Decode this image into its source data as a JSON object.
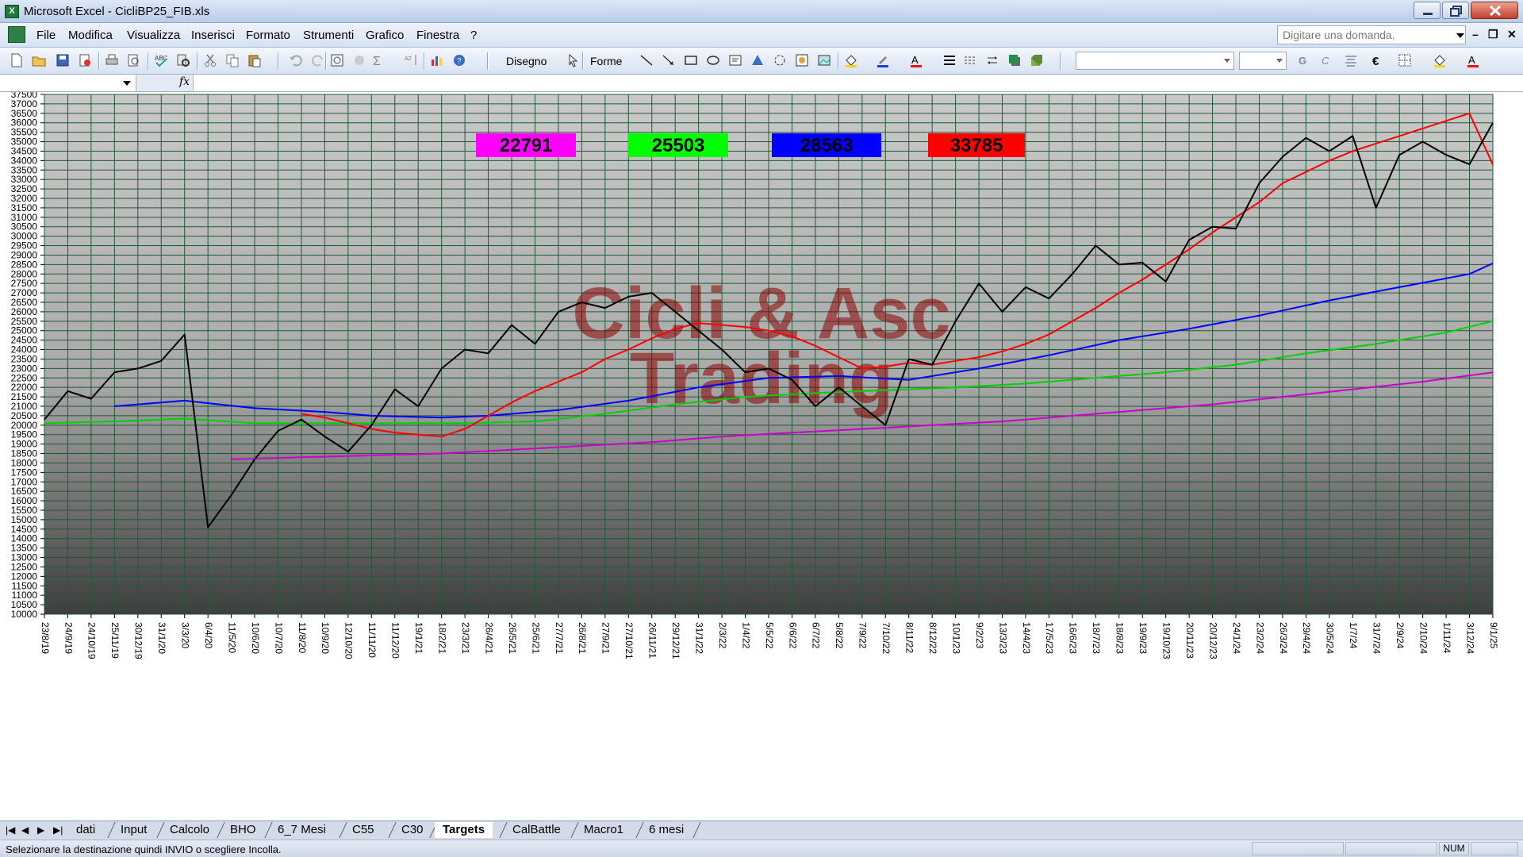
{
  "window": {
    "title": "Microsoft Excel - CicliBP25_FIB.xls",
    "app_icon": "excel-icon"
  },
  "menu": {
    "items": [
      "File",
      "Modifica",
      "Visualizza",
      "Inserisci",
      "Formato",
      "Strumenti",
      "Grafico",
      "Finestra",
      "?"
    ],
    "ask_placeholder": "Digitare una domanda."
  },
  "toolbar": {
    "disegno_label": "Disegno",
    "forme_label": "Forme"
  },
  "chart_data": {
    "type": "line",
    "ylim": [
      10000,
      37500
    ],
    "yticks": [
      10000,
      10500,
      11000,
      11500,
      12000,
      12500,
      13000,
      13500,
      14000,
      14500,
      15000,
      15500,
      16000,
      16500,
      17000,
      17500,
      18000,
      18500,
      19000,
      19500,
      20000,
      20500,
      21000,
      21500,
      22000,
      22500,
      23000,
      23500,
      24000,
      24500,
      25000,
      25500,
      26000,
      26500,
      27000,
      27500,
      28000,
      28500,
      29000,
      29500,
      30000,
      30500,
      31000,
      31500,
      32000,
      32500,
      33000,
      33500,
      34000,
      34500,
      35000,
      35500,
      36000,
      36500,
      37000,
      37500
    ],
    "x_tick_labels": [
      "23/8/19",
      "24/9/19",
      "24/10/19",
      "25/11/19",
      "30/12/19",
      "31/1/20",
      "3/3/20",
      "6/4/20",
      "11/5/20",
      "10/6/20",
      "10/7/20",
      "11/8/20",
      "10/9/20",
      "12/10/20",
      "11/11/20",
      "11/12/20",
      "19/1/21",
      "18/2/21",
      "23/3/21",
      "26/4/21",
      "26/5/21",
      "25/6/21",
      "27/7/21",
      "26/8/21",
      "27/9/21",
      "27/10/21",
      "26/11/21",
      "29/12/21",
      "31/1/22",
      "2/3/22",
      "1/4/22",
      "5/5/22",
      "6/6/22",
      "6/7/22",
      "5/8/22",
      "7/9/22",
      "7/10/22",
      "8/11/22",
      "8/12/22",
      "10/1/23",
      "9/2/23",
      "13/3/23",
      "14/4/23",
      "17/5/23",
      "16/6/23",
      "18/7/23",
      "18/8/23",
      "19/9/23",
      "19/10/23",
      "20/11/23",
      "20/12/23",
      "24/1/24",
      "23/2/24",
      "26/3/24",
      "29/4/24",
      "30/5/24",
      "1/7/24",
      "31/7/24",
      "2/9/24",
      "2/10/24",
      "1/11/24",
      "3/12/24",
      "9/1/25"
    ],
    "badges": [
      {
        "value": "22791",
        "color": "#ff00ff"
      },
      {
        "value": "25503",
        "color": "#00ff00"
      },
      {
        "value": "28563",
        "color": "#0000ff"
      },
      {
        "value": "33785",
        "color": "#ff0000"
      }
    ],
    "watermark_line1": "Cicli & Asc",
    "watermark_line2": "Trading",
    "series": [
      {
        "color": "#000000",
        "x": [
          0,
          1,
          2,
          3,
          4,
          5,
          6,
          7,
          8,
          9,
          10,
          11,
          12,
          13,
          14,
          15,
          16,
          17,
          18,
          19,
          20,
          21,
          22,
          23,
          24,
          25,
          26,
          27,
          28,
          29,
          30,
          31,
          32,
          33,
          34,
          35,
          36,
          37,
          38,
          39,
          40,
          41,
          42,
          43,
          44,
          45,
          46,
          47,
          48,
          49,
          50,
          51,
          52,
          53,
          54,
          55,
          56,
          57,
          58,
          59,
          60,
          61,
          62
        ],
        "y": [
          20300,
          21800,
          21400,
          22800,
          23000,
          23400,
          24800,
          14600,
          16300,
          18200,
          19700,
          20300,
          19400,
          18600,
          20000,
          21900,
          21000,
          23000,
          24000,
          23800,
          25300,
          24300,
          26000,
          26500,
          26200,
          26800,
          27000,
          26000,
          25000,
          24000,
          22800,
          23000,
          22400,
          21000,
          22000,
          21000,
          20000,
          23500,
          23200,
          25500,
          27500,
          26000,
          27300,
          26700,
          28000,
          29500,
          28500,
          28600,
          27600,
          29800,
          30500,
          30400,
          32800,
          34200,
          35200,
          34500,
          35300,
          31500,
          34300,
          35000,
          34300,
          33800,
          36000
        ]
      },
      {
        "color": "#ff0000",
        "x": [
          11,
          12,
          13,
          14,
          15,
          16,
          17,
          18,
          19,
          20,
          21,
          22,
          23,
          24,
          25,
          26,
          27,
          28,
          29,
          30,
          31,
          32,
          33,
          34,
          35,
          36,
          37,
          38,
          39,
          40,
          41,
          42,
          43,
          44,
          45,
          46,
          47,
          48,
          49,
          50,
          51,
          52,
          53,
          54,
          55,
          56,
          57,
          58,
          59,
          60,
          61,
          62
        ],
        "y": [
          20600,
          20400,
          20100,
          19800,
          19600,
          19500,
          19400,
          19800,
          20500,
          21200,
          21800,
          22300,
          22800,
          23500,
          24000,
          24600,
          25100,
          25400,
          25300,
          25200,
          25000,
          24700,
          24200,
          23600,
          23000,
          23100,
          23300,
          23200,
          23400,
          23600,
          23900,
          24300,
          24800,
          25500,
          26200,
          27000,
          27700,
          28500,
          29300,
          30200,
          31000,
          31800,
          32800,
          33400,
          34000,
          34500,
          34900,
          35300,
          35700,
          36100,
          36500,
          33785
        ]
      },
      {
        "color": "#0000ff",
        "x": [
          3,
          6,
          9,
          12,
          14,
          17,
          19,
          22,
          25,
          28,
          31,
          34,
          37,
          40,
          43,
          46,
          49,
          52,
          55,
          58,
          61,
          62
        ],
        "y": [
          21000,
          21300,
          20900,
          20700,
          20500,
          20400,
          20500,
          20800,
          21300,
          22000,
          22500,
          22600,
          22400,
          23000,
          23700,
          24500,
          25100,
          25800,
          26600,
          27300,
          28000,
          28563
        ]
      },
      {
        "color": "#00d000",
        "x": [
          0,
          3,
          6,
          9,
          12,
          15,
          18,
          21,
          24,
          27,
          30,
          33,
          36,
          39,
          42,
          45,
          48,
          51,
          54,
          57,
          60,
          62
        ],
        "y": [
          20100,
          20200,
          20350,
          20100,
          20100,
          20100,
          20100,
          20200,
          20600,
          21100,
          21500,
          21700,
          21850,
          22000,
          22200,
          22500,
          22800,
          23200,
          23800,
          24300,
          24900,
          25503
        ]
      },
      {
        "color": "#cc00cc",
        "x": [
          8,
          11,
          14,
          17,
          20,
          23,
          26,
          29,
          32,
          35,
          38,
          41,
          44,
          47,
          50,
          53,
          56,
          59,
          62
        ],
        "y": [
          18200,
          18300,
          18400,
          18500,
          18700,
          18900,
          19100,
          19400,
          19600,
          19800,
          20000,
          20200,
          20500,
          20800,
          21100,
          21500,
          21900,
          22300,
          22791
        ]
      }
    ]
  },
  "sheet_tabs": [
    "dati",
    "Input",
    "Calcolo",
    "BHO",
    "6_7 Mesi",
    "C55",
    "C30",
    "Targets",
    "CalBattle",
    "Macro1",
    "6 mesi"
  ],
  "active_tab": "Targets",
  "status": {
    "message": "Selezionare la destinazione quindi INVIO o scegliere Incolla.",
    "num": "NUM"
  }
}
